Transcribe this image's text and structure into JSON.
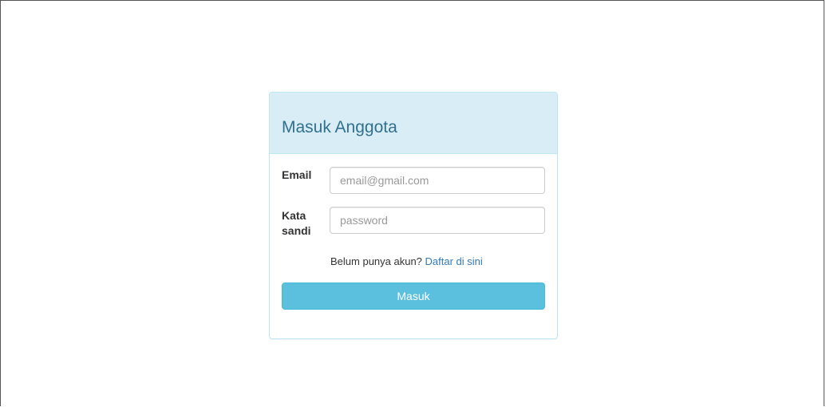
{
  "panel": {
    "title": "Masuk Anggota"
  },
  "form": {
    "email_label": "Email",
    "email_placeholder": "email@gmail.com",
    "email_value": "",
    "password_label_line1": "Kata",
    "password_label_line2": "sandi",
    "password_placeholder": "password",
    "password_value": "",
    "register_prompt": "Belum punya akun?",
    "register_link": "Daftar di sini",
    "submit_label": "Masuk"
  },
  "colors": {
    "heading_bg": "#d9edf7",
    "heading_text": "#31708f",
    "panel_border": "#bce8f1",
    "button_bg": "#5bc0de",
    "link": "#337ab7"
  }
}
